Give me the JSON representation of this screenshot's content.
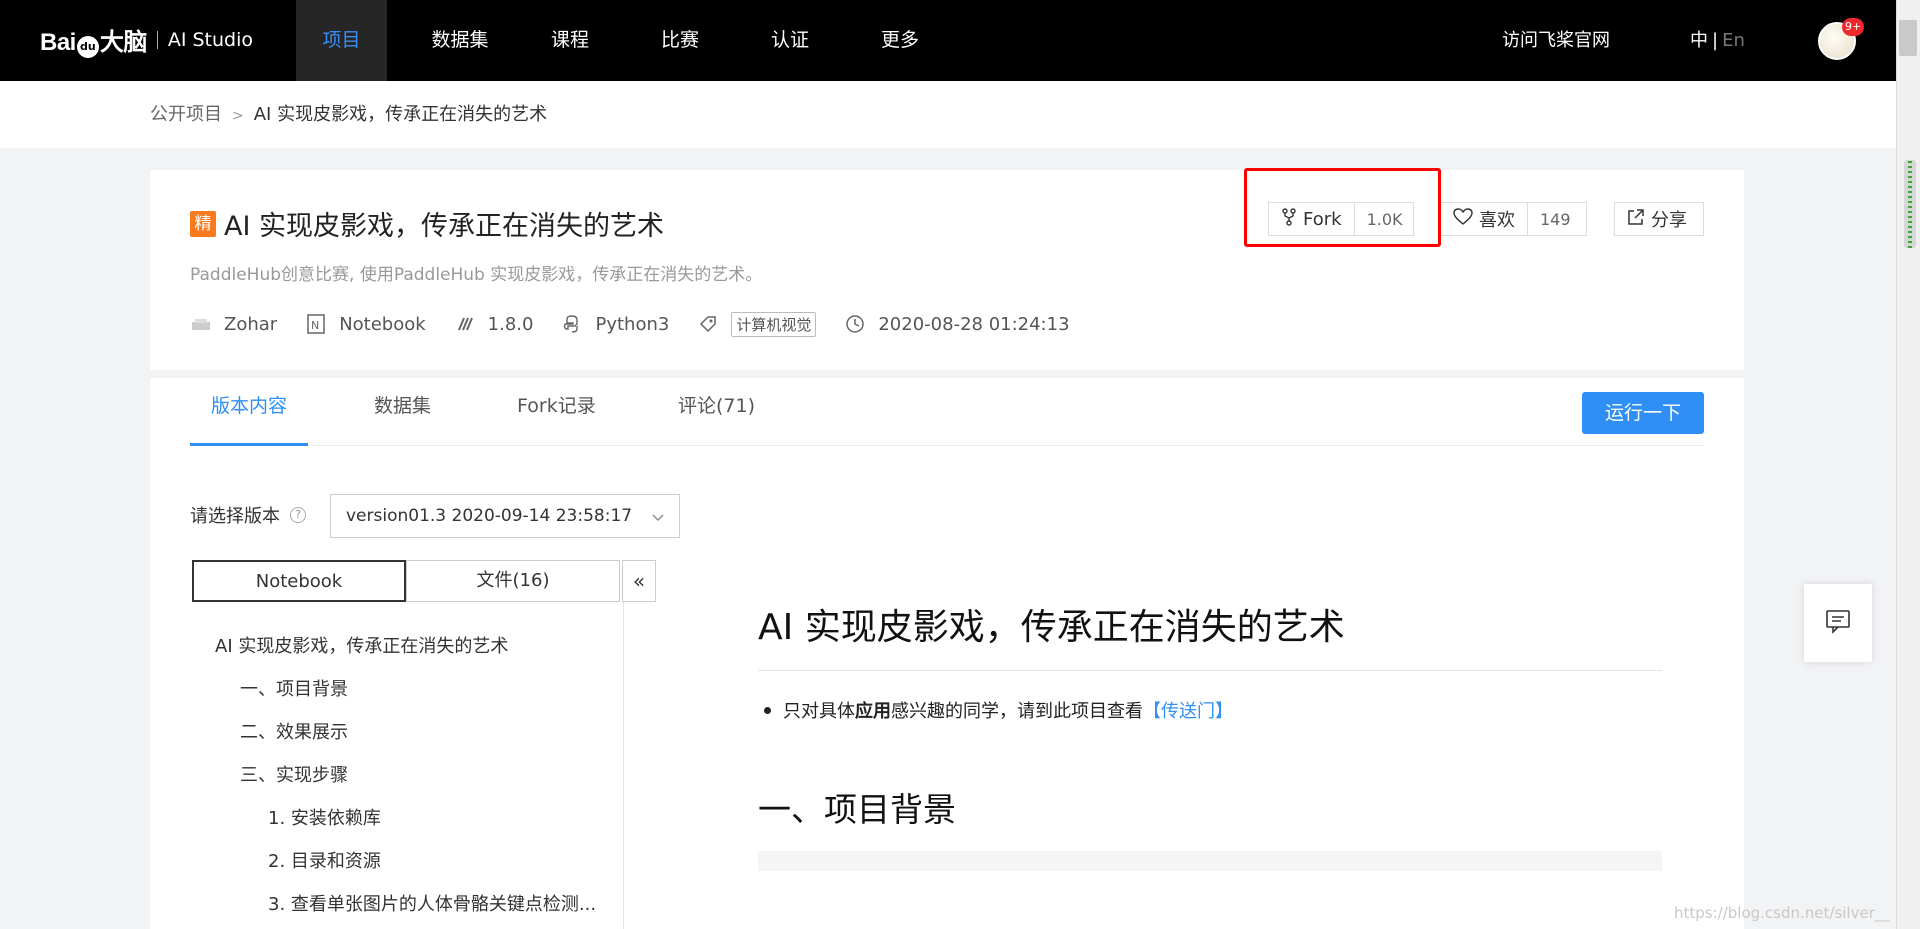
{
  "nav": {
    "logo_text": "Bai",
    "logo_paw": "du",
    "logo_cn": "大脑",
    "logo_product": "AI Studio",
    "items": [
      "项目",
      "数据集",
      "课程",
      "比赛",
      "认证",
      "更多"
    ],
    "official_site": "访问飞桨官网",
    "lang_zh": "中",
    "lang_sep": "|",
    "lang_en": "En",
    "notification_count": "9+"
  },
  "breadcrumb": {
    "parent": "公开项目",
    "separator": ">",
    "current": "AI 实现皮影戏，传承正在消失的艺术"
  },
  "project": {
    "badge": "精",
    "title": "AI 实现皮影戏，传承正在消失的艺术",
    "description": "PaddleHub创意比赛, 使用PaddleHub 实现皮影戏，传承正在消失的艺术。",
    "author": "Zohar",
    "type": "Notebook",
    "paddle_version": "1.8.0",
    "language": "Python3",
    "tag": "计算机视觉",
    "date": "2020-08-28 01:24:13",
    "fork_label": "Fork",
    "fork_count": "1.0K",
    "like_label": "喜欢",
    "like_count": "149",
    "share_label": "分享"
  },
  "tabs": [
    "版本内容",
    "数据集",
    "Fork记录",
    "评论(71)"
  ],
  "run_button": "运行一下",
  "version": {
    "label": "请选择版本",
    "help": "?",
    "selected": "version01.3 2020-09-14 23:58:17"
  },
  "side_tabs": {
    "notebook": "Notebook",
    "files": "文件(16)",
    "collapse": "«"
  },
  "toc": [
    "AI 实现皮影戏，传承正在消失的艺术",
    "一、项目背景",
    "二、效果展示",
    "三、实现步骤",
    "1. 安装依赖库",
    "2. 目录和资源",
    "3. 查看单张图片的人体骨骼关键点检测..."
  ],
  "document": {
    "h1": "AI 实现皮影戏，传承正在消失的艺术",
    "bullet_prefix": "只对具体",
    "bullet_bold": "应用",
    "bullet_mid": "感兴趣的同学，请到此项目查看",
    "bullet_link": "【传送门】",
    "h2": "一、项目背景"
  },
  "watermark": "https://blog.csdn.net/silver__"
}
